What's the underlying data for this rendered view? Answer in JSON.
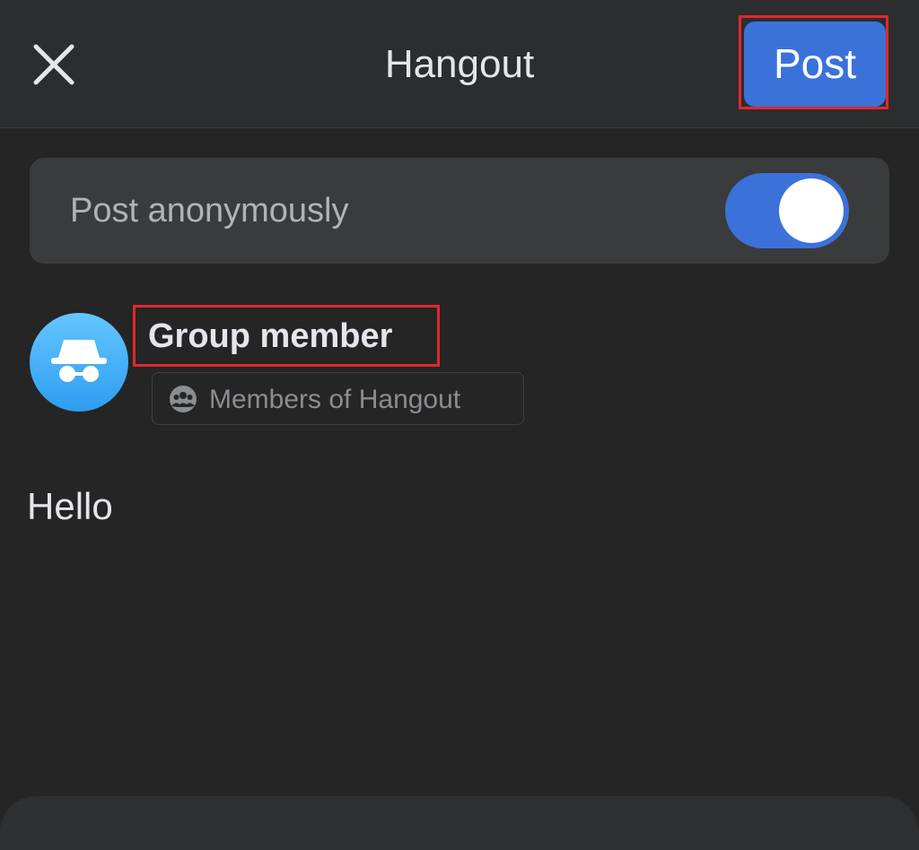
{
  "header": {
    "title": "Hangout",
    "post_label": "Post"
  },
  "anonymous": {
    "label": "Post anonymously",
    "enabled": true
  },
  "author": {
    "name": "Group member",
    "audience": "Members of Hangout"
  },
  "composer": {
    "text": "Hello"
  },
  "colors": {
    "accent": "#3b72d9",
    "highlight": "#e0282f",
    "background": "#252525",
    "avatar": "#2e9df0"
  },
  "icons": {
    "close": "close-icon",
    "avatar": "incognito-icon",
    "audience": "group-icon"
  }
}
